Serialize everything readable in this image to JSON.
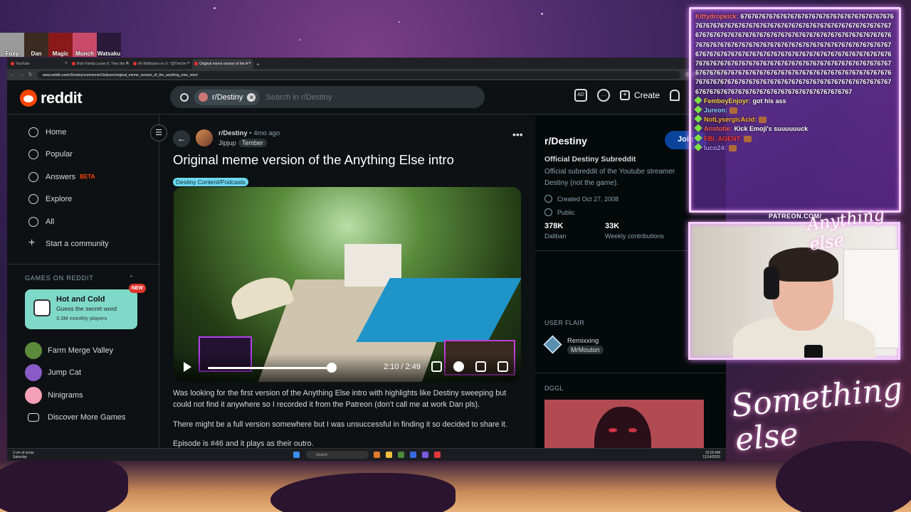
{
  "stream_avatars": [
    {
      "label": "Foxy",
      "color": "#9a9a9a"
    },
    {
      "label": "Dan",
      "color": "#3a2a20"
    },
    {
      "label": "Magic",
      "color": "#8a1a1a"
    },
    {
      "label": "Munch",
      "color": "#c94a6a"
    },
    {
      "label": "Watsaku",
      "color": "#2a1a3a"
    }
  ],
  "browser": {
    "tabs": [
      {
        "label": "YouTube"
      },
      {
        "label": "Rich Family Loses It, Then the %"
      },
      {
        "label": "(4) MrMouton on X: \"@TheOm"
      },
      {
        "label": "Original meme version of the A"
      }
    ],
    "new_tab": "+",
    "url": "www.reddit.com/r/Destiny/comments/1lwfyom/original_meme_version_of_the_anything_else_intro/",
    "zoom": "200%"
  },
  "reddit": {
    "logo": "reddit",
    "search_chip": "r/Destiny",
    "search_placeholder": "Search in r/Destiny",
    "create": "Create",
    "nav": [
      {
        "label": "Home"
      },
      {
        "label": "Popular"
      },
      {
        "label": "Answers"
      },
      {
        "label": "Explore"
      },
      {
        "label": "All"
      },
      {
        "label": "Start a community"
      }
    ],
    "beta": "BETA",
    "games_header": "GAMES ON REDDIT",
    "game_card": {
      "title": "Hot and Cold",
      "subtitle": "Guess the secret word",
      "players": "3.3M monthly players",
      "badge": "NEW"
    },
    "games": [
      {
        "label": "Farm Merge Valley"
      },
      {
        "label": "Jump Cat"
      },
      {
        "label": "Ninigrams"
      },
      {
        "label": "Discover More Games"
      }
    ],
    "post": {
      "subreddit": "r/Destiny",
      "ago": "• 4mo ago",
      "user": "Jipjup",
      "user_flair": "Tember",
      "title": "Original meme version of the Anything Else intro",
      "flair": "Destiny Content/Podcasts",
      "video_time": "2:10 / 2:49",
      "video_progress": 0.78,
      "paragraphs": [
        "Was looking for the first version of the Anything Else intro with highlights like Destiny sweeping but could not find it anywhere so I recorded it from the Patreon (don't call me at work Dan pls).",
        "There might be a full version somewhere but I was unsuccessful in finding it so decided to share it.",
        "Episode is #46 and it plays as their outro."
      ]
    },
    "side": {
      "title": "r/Destiny",
      "join": "Join",
      "subtitle": "Official Destiny Subreddit",
      "desc": "Official subreddit of the Youtube streamer Destiny (not the game).",
      "created": "Created Oct 27, 2008",
      "visibility": "Public",
      "stat1_n": "378K",
      "stat1_l": "Daliban",
      "stat2_n": "33K",
      "stat2_l": "Weekly contributions",
      "user_flair_h": "USER FLAIR",
      "uf_name": "Remixxing",
      "uf_flair": "MrMouton",
      "dggl_h": "DGGL"
    }
  },
  "taskbar": {
    "weather": "3 cm of snow",
    "weather_sub": "Saturday",
    "search": "Search",
    "time": "10:25 AM",
    "date": "11/14/2025"
  },
  "chat": {
    "messages": [
      {
        "user": "Kittydropkick:",
        "text": "6767676767676767676767676767676767676767676767676767676767676767676767676767676767676767676767676767676767676767676767676767676767676767676767676767676767676767676767676767676767676767676767676767676767676767676767676767676767676767676767676767676767676767676767676767676767676767676767676767676767676767676767676767676767676767676767676767676767676767676767676767676767676767676767676767676767676767676767676767676767676767676767676767676767676767676767676767676767676767",
        "color": "#ff6a6a"
      },
      {
        "user": "FemboyEnjoyr:",
        "text": "got his ass",
        "color": "#ffd84a"
      },
      {
        "user": "Jureon:",
        "text": "",
        "color": "#8ad0ff"
      },
      {
        "user": "NotLysergicAcid:",
        "text": "",
        "color": "#ffb02e"
      },
      {
        "user": "Aristotle:",
        "text": "Kick Emoji's suuuuuuck",
        "color": "#ff5a5a"
      },
      {
        "user": "FBI_AGENT:",
        "text": "",
        "color": "#ff3a3a"
      },
      {
        "user": "luco24:",
        "text": "",
        "color": "#b58fff"
      }
    ]
  },
  "overlay": {
    "patreon": "PATREON.COM/",
    "brand_top": "Anything else",
    "brand_bottom": "Something else"
  }
}
